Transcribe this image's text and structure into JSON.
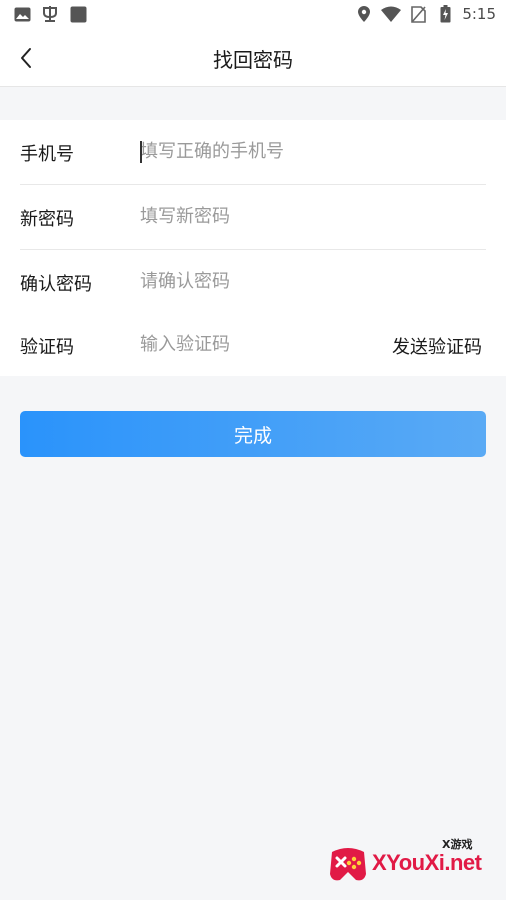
{
  "status_bar": {
    "time": "5:15",
    "left_icons": [
      "image-icon",
      "bug-icon",
      "square-app-icon"
    ],
    "right_icons": [
      "location-icon",
      "wifi-icon",
      "no-sim-icon",
      "battery-charging-icon"
    ]
  },
  "header": {
    "title": "找回密码",
    "back_icon": "chevron-left-icon"
  },
  "form": {
    "phone": {
      "label": "手机号",
      "placeholder": "填写正确的手机号",
      "value": ""
    },
    "new_password": {
      "label": "新密码",
      "placeholder": "填写新密码",
      "value": ""
    },
    "confirm_password": {
      "label": "确认密码",
      "placeholder": "请确认密码",
      "value": ""
    },
    "verify_code": {
      "label": "验证码",
      "placeholder": "输入验证码",
      "value": "",
      "send_label": "发送验证码"
    }
  },
  "submit": {
    "label": "完成"
  },
  "watermark": {
    "text": "XYouXi.net",
    "tag": "X游戏"
  },
  "colors": {
    "accent_start": "#2a93fb",
    "accent_end": "#5aaaf5",
    "background": "#f5f6f8",
    "watermark": "#e11a46"
  }
}
